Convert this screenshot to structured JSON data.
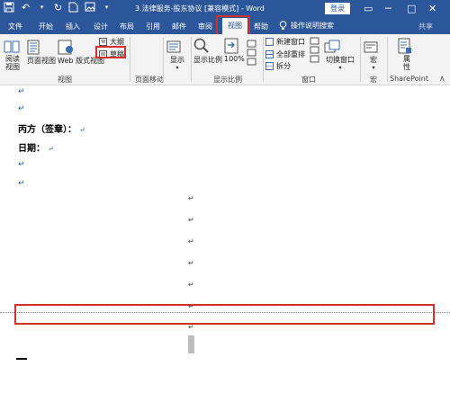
{
  "app": {
    "title": "3.法律服务-股东协议 [兼容模式] - Word",
    "signin_label": "登录",
    "share_label": "共享"
  },
  "tabs": [
    {
      "label": "文件"
    },
    {
      "label": "开始"
    },
    {
      "label": "插入"
    },
    {
      "label": "设计"
    },
    {
      "label": "布局"
    },
    {
      "label": "引用"
    },
    {
      "label": "邮件"
    },
    {
      "label": "审阅"
    },
    {
      "label": "视图"
    },
    {
      "label": "帮助"
    }
  ],
  "tell_me": "操作说明搜索",
  "ribbon": {
    "views": {
      "read_mode": "阅读\n视图",
      "print_layout": "页面视图",
      "web_layout": "Web 版式视图",
      "outline": "大纲",
      "draft": "草稿",
      "group_label": "视图"
    },
    "page_movement": {
      "group_label": "页面移动"
    },
    "show": {
      "label": "显示",
      "group_label": ""
    },
    "zoom": {
      "zoom": "显示比例",
      "hundred": "100%",
      "group_label": "显示比例"
    },
    "window": {
      "new_window": "新建窗口",
      "arrange_all": "全部重排",
      "split": "拆分",
      "switch_windows": "切换窗口",
      "group_label": "窗口"
    },
    "macros": {
      "label": "宏",
      "group_label": "宏"
    },
    "sharepoint": {
      "label": "属\n性",
      "group_label": "SharePoint"
    }
  },
  "document": {
    "line_party_c": "丙方（签章）：",
    "line_date": "日期：",
    "para_mark": "↵"
  },
  "colors": {
    "accent": "#2b579a",
    "highlight": "#d32f2f"
  }
}
